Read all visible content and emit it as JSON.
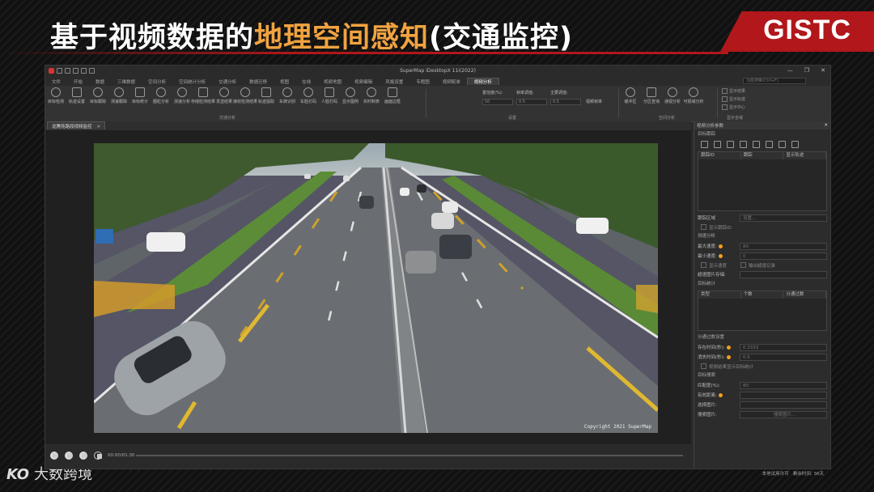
{
  "slide": {
    "title_main": "基于视频数据的",
    "title_highlight": "地理空间感知",
    "title_tail": "(交通监控)",
    "logo": "GISTC",
    "footer_mark": "KO",
    "footer_text": "大数跨境"
  },
  "app": {
    "title": "SuperMap iDesktopX 11i(2022)",
    "search_placeholder": "功能搜索(Ctrl+F)",
    "menu": [
      "文件",
      "开始",
      "数据",
      "三维数据",
      "空间分析",
      "空间统计分析",
      "交通分析",
      "数据迁移",
      "视图",
      "在线",
      "视频地图",
      "视频编辑",
      "风格设置",
      "专题图",
      "视频配准",
      "视频分析"
    ],
    "active_menu": "视频分析",
    "ribbon": {
      "traffic_buttons": [
        "目标检测",
        "轨迹设置",
        "目标跟踪",
        "测速跟踪",
        "目标统计",
        "圈粒分析",
        "测速分析",
        "存储检测结果",
        "发送结果",
        "接收检测结果",
        "轨迹提取",
        "车牌识别",
        "车脸打码",
        "人脸打码",
        "显示图例",
        "实时制表",
        "画面边框"
      ],
      "traffic_group": "交通分析",
      "settings_group": "设置",
      "spatial_group": "空间分析",
      "display_group": "显示全域",
      "fields": {
        "confidence_label": "置信度(%):",
        "confidence_value": "50",
        "nms_label": "帧率调值:",
        "nms_value": "0.5",
        "main_label": "主要调值:",
        "main_value": "0.5",
        "video_label": "视频帧率"
      },
      "spatial_buttons": [
        "缓冲区",
        "分区查询",
        "通视分析",
        "可视域分析"
      ],
      "checks": [
        "显示结果",
        "显示轨迹",
        "显示中心"
      ]
    },
    "doc_tab": "龙腾苑路段视频监控",
    "copyright": "Copyright 2021 SuperMap",
    "player_time": "00:00/01:30",
    "panel": {
      "title": "视频分析参数",
      "target_section": "目标跟踪",
      "table_headers": [
        "跟踪ID",
        "跟踪",
        "显示轨迹"
      ],
      "region_label": "跟踪区域",
      "region_value": "设置...",
      "show_label": "显示跟踪ID",
      "speed_section": "测速分析",
      "max_speed_label": "最大速度:",
      "max_speed_value": "80",
      "min_speed_label": "最小速度:",
      "min_speed_value": "0",
      "show_speed": "显示速度",
      "output_record": "输出超速记录",
      "save_label": "超速图片存储:",
      "stats_section": "目标统计",
      "stats_headers": [
        "类型",
        "个数",
        "分通过数"
      ],
      "passing_section": "分通过数设置",
      "exist_label": "存在时间(秒):",
      "exist_value": "0.3333",
      "vanish_label": "消失时间(秒):",
      "vanish_value": "0.5",
      "count_label": "视频结果显示目标统计",
      "search_section": "目标搜索",
      "match_label": "匹配度(%):",
      "match_value": "80",
      "valid_label": "有效距离:",
      "select_label": "选择图片:",
      "image_label": "搜索图片:",
      "image_value": "搜索图片..."
    },
    "status_left": "本地试用许可",
    "status_right": "剩余时间: 36天"
  }
}
